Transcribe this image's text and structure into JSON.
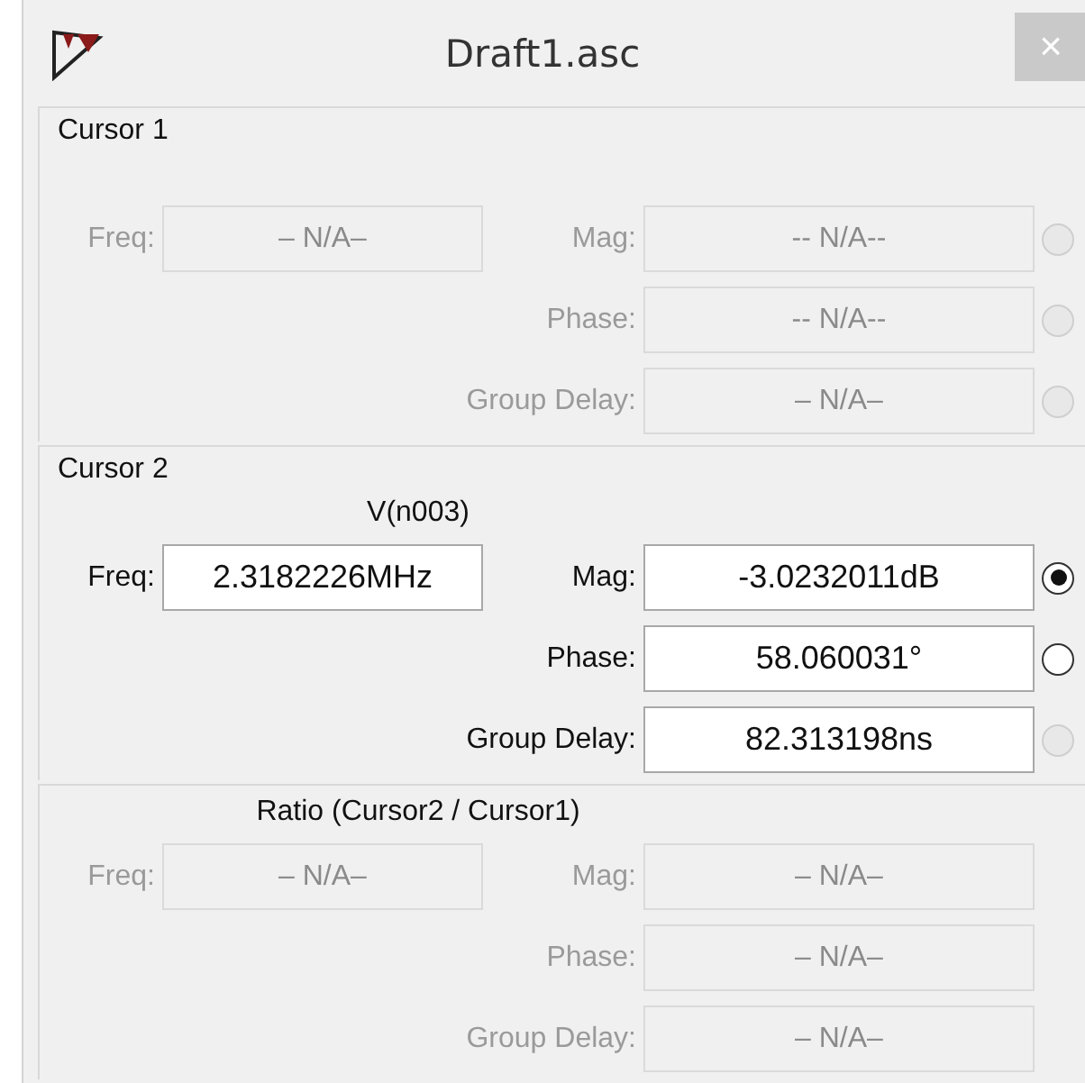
{
  "window": {
    "title": "Draft1.asc",
    "close": "×"
  },
  "groups": [
    {
      "title": "Cursor 1",
      "disabled": true,
      "freq": {
        "label": "Freq:",
        "value": "– N/A–"
      },
      "rows": [
        {
          "label": "Mag:",
          "value": "-- N/A--",
          "radio": {
            "selected": false,
            "disabled": true
          }
        },
        {
          "label": "Phase:",
          "value": "-- N/A--",
          "radio": {
            "selected": false,
            "disabled": true
          }
        },
        {
          "label": "Group Delay:",
          "value": "– N/A–",
          "radio": {
            "selected": false,
            "disabled": true
          }
        }
      ]
    },
    {
      "title": "Cursor 2",
      "subtitle": "V(n003)",
      "disabled": false,
      "freq": {
        "label": "Freq:",
        "value": "2.3182226MHz"
      },
      "rows": [
        {
          "label": "Mag:",
          "value": "-3.0232011dB",
          "radio": {
            "selected": true,
            "disabled": false
          }
        },
        {
          "label": "Phase:",
          "value": "58.060031°",
          "radio": {
            "selected": false,
            "disabled": false
          }
        },
        {
          "label": "Group Delay:",
          "value": "82.313198ns",
          "radio": {
            "selected": false,
            "disabled": true
          }
        }
      ]
    },
    {
      "subtitle": "Ratio (Cursor2 / Cursor1)",
      "disabled": true,
      "freq": {
        "label": "Freq:",
        "value": "– N/A–"
      },
      "rows": [
        {
          "label": "Mag:",
          "value": "– N/A–"
        },
        {
          "label": "Phase:",
          "value": "– N/A–"
        },
        {
          "label": "Group Delay:",
          "value": "– N/A–"
        }
      ]
    }
  ]
}
